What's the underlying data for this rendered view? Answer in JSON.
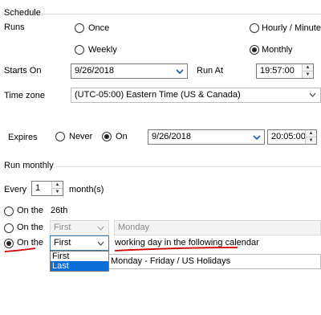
{
  "schedule": {
    "title": "Schedule",
    "runs_label": "Runs",
    "options": {
      "once": "Once",
      "hourly": "Hourly / Minutely",
      "weekly": "Weekly",
      "monthly": "Monthly"
    },
    "selected": "monthly",
    "starts_on_label": "Starts On",
    "starts_on_value": "9/26/2018",
    "run_at_label": "Run At",
    "run_at_value": "19:57:00",
    "timezone_label": "Time zone",
    "timezone_value": "(UTC-05:00) Eastern Time (US & Canada)",
    "expires_label": "Expires",
    "never_label": "Never",
    "on_label": "On",
    "expires_selected": "on",
    "expires_date": "9/26/2018",
    "expires_time": "20:05:00"
  },
  "run_monthly": {
    "title": "Run monthly",
    "every_label": "Every",
    "every_value": "1",
    "months_label": "month(s)",
    "row1_label": "On the",
    "row1_day": "26th",
    "row2_label": "On the",
    "row2_first": "First",
    "row2_day": "Monday",
    "row3_label": "On the",
    "row3_first": "First",
    "row3_text": "working day in the following calendar",
    "calendar_value": "Monday - Friday / US Holidays",
    "dropdown_options": [
      "First",
      "Last"
    ],
    "dropdown_selected": "Last",
    "selected_row": 3,
    "annotation_color": "#d40000",
    "select_highlight_color": "#0a6ed6"
  }
}
